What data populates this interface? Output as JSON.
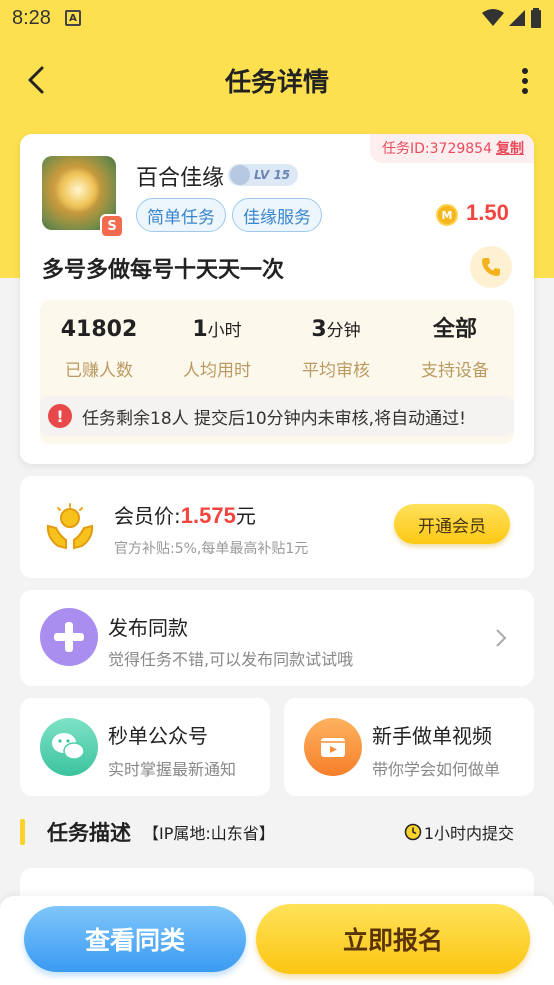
{
  "status_bar": {
    "time": "8:28",
    "notification_icon": "A"
  },
  "nav": {
    "title": "任务详情"
  },
  "task": {
    "id_label": "任务ID:3729854",
    "copy_label": "复制",
    "publisher_name": "百合佳缘",
    "level": "LV 15",
    "avatar_badge": "S",
    "tags": [
      "简单任务",
      "佳缘服务"
    ],
    "reward": "1.50",
    "coin_symbol": "M",
    "title": "多号多做每号十天天一次"
  },
  "stats": [
    {
      "value": "41802",
      "unit": "",
      "label": "已赚人数"
    },
    {
      "value": "1",
      "unit": "小时",
      "label": "人均用时"
    },
    {
      "value": "3",
      "unit": "分钟",
      "label": "平均审核"
    },
    {
      "value": "全部",
      "unit": "",
      "label": "支持设备"
    }
  ],
  "notice": {
    "icon": "!",
    "text": "任务剩余18人  提交后10分钟内未审核,将自动通过!"
  },
  "vip": {
    "label": "会员价:",
    "price": "1.575",
    "unit": "元",
    "subsidy": "官方补贴:5%,每单最高补贴1元",
    "button": "开通会员"
  },
  "publish": {
    "title": "发布同款",
    "subtitle": "觉得任务不错,可以发布同款试试哦"
  },
  "shortcuts": [
    {
      "title": "秒单公众号",
      "subtitle": "实时掌握最新通知"
    },
    {
      "title": "新手做单视频",
      "subtitle": "带你学会如何做单"
    }
  ],
  "section": {
    "heading": "任务描述",
    "ip": "【IP属地:山东省】",
    "deadline": "1小时内提交"
  },
  "bottom": {
    "similar_button": "查看同类",
    "signup_button": "立即报名"
  },
  "colors": {
    "accent_yellow": "#fde04f",
    "price_red": "#f2453d",
    "tag_blue": "#3a86cc"
  }
}
